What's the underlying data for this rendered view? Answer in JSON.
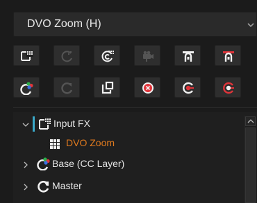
{
  "node_selector": {
    "value": "DVO Zoom (H)"
  },
  "toolbar": {
    "row1": [
      {
        "icon": "add-node-icon",
        "enabled": true
      },
      {
        "icon": "circle-node-icon",
        "enabled": false
      },
      {
        "icon": "stacked-node-icon",
        "enabled": true
      },
      {
        "icon": "camera-node-icon",
        "enabled": false
      },
      {
        "icon": "insert-before-icon",
        "enabled": true
      },
      {
        "icon": "insert-after-icon",
        "enabled": true
      }
    ],
    "row2": [
      {
        "icon": "color-layer-icon",
        "enabled": true
      },
      {
        "icon": "refresh-node-icon",
        "enabled": false
      },
      {
        "icon": "duplicate-node-icon",
        "enabled": true
      },
      {
        "icon": "delete-node-icon",
        "enabled": true
      },
      {
        "icon": "record-icon",
        "enabled": true
      },
      {
        "icon": "record-alt-icon",
        "enabled": true
      }
    ]
  },
  "tree": {
    "items": [
      {
        "label": "Input FX",
        "expanded": true,
        "selected": true
      },
      {
        "label": "DVO Zoom",
        "active": true
      },
      {
        "label": "Base (CC Layer)",
        "expanded": false
      },
      {
        "label": "Master",
        "expanded": false
      }
    ]
  },
  "colors": {
    "accent": "#3aa9c9",
    "active_text": "#e07a1f",
    "red_icon": "#e0343a"
  }
}
